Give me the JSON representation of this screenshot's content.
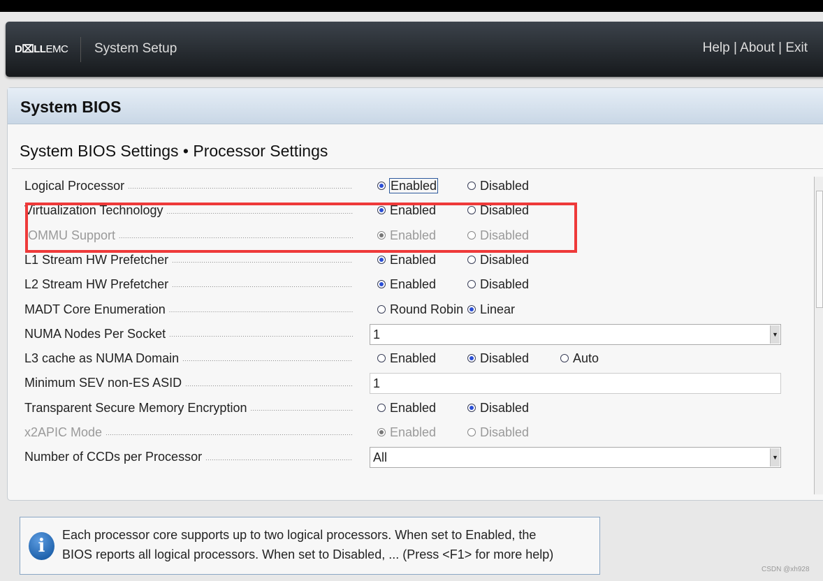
{
  "header": {
    "logo": "DELLEMC",
    "title": "System Setup",
    "links": [
      "Help",
      "About",
      "Exit"
    ],
    "separator": "|"
  },
  "panel": {
    "title": "System BIOS",
    "subtitle": "System BIOS Settings • Processor Settings"
  },
  "settings": [
    {
      "label": "Logical Processor",
      "type": "radio",
      "options": [
        "Enabled",
        "Disabled"
      ],
      "selected": 0,
      "disabled": false,
      "focused": true
    },
    {
      "label": "Virtualization Technology",
      "type": "radio",
      "options": [
        "Enabled",
        "Disabled"
      ],
      "selected": 0,
      "disabled": false
    },
    {
      "label": "IOMMU Support",
      "type": "radio",
      "options": [
        "Enabled",
        "Disabled"
      ],
      "selected": 0,
      "disabled": true
    },
    {
      "label": "L1 Stream HW Prefetcher",
      "type": "radio",
      "options": [
        "Enabled",
        "Disabled"
      ],
      "selected": 0,
      "disabled": false
    },
    {
      "label": "L2 Stream HW Prefetcher",
      "type": "radio",
      "options": [
        "Enabled",
        "Disabled"
      ],
      "selected": 0,
      "disabled": false
    },
    {
      "label": "MADT Core Enumeration",
      "type": "radio",
      "options": [
        "Round Robin",
        "Linear"
      ],
      "selected": 1,
      "disabled": false
    },
    {
      "label": "NUMA Nodes Per Socket",
      "type": "select",
      "value": "1"
    },
    {
      "label": "L3 cache as NUMA Domain",
      "type": "radio",
      "options": [
        "Enabled",
        "Disabled",
        "Auto"
      ],
      "selected": 1,
      "disabled": false
    },
    {
      "label": "Minimum SEV non-ES ASID",
      "type": "text",
      "value": "1"
    },
    {
      "label": "Transparent Secure Memory Encryption",
      "type": "radio",
      "options": [
        "Enabled",
        "Disabled"
      ],
      "selected": 1,
      "disabled": false
    },
    {
      "label": "x2APIC Mode",
      "type": "radio",
      "options": [
        "Enabled",
        "Disabled"
      ],
      "selected": 0,
      "disabled": true
    },
    {
      "label": "Number of CCDs per Processor",
      "type": "select",
      "value": "All"
    }
  ],
  "help": {
    "icon": "info-icon",
    "line1": "Each processor core supports up to two logical processors. When set to Enabled, the",
    "line2": "BIOS reports all logical processors. When set to Disabled, ... (Press <F1> for more help)"
  },
  "watermark": "CSDN @xh928",
  "colors": {
    "highlight_box": "#ee3a3a",
    "radio_selected": "#2b4fd6"
  }
}
